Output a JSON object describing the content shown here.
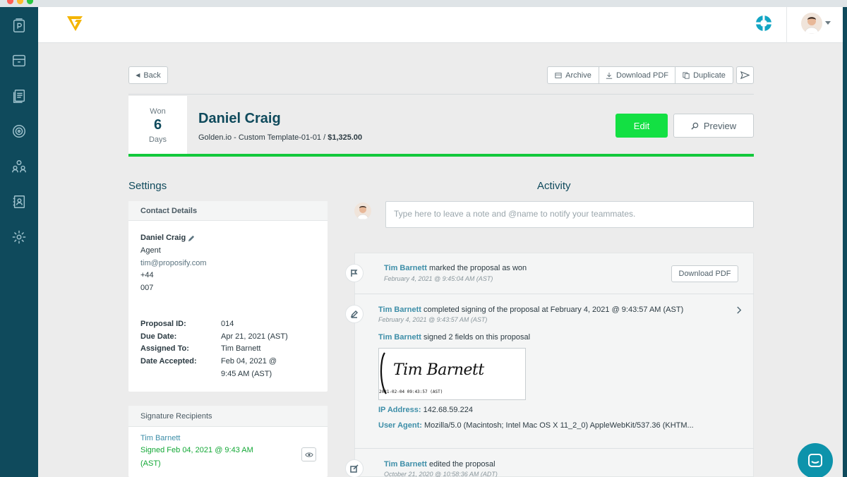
{
  "app": {
    "colors": {
      "rail": "#0f4a5c",
      "accent_green": "#13e043",
      "progress_green": "#13c93c",
      "link": "#3d8ea8"
    }
  },
  "rail_icons": [
    "proposals-icon",
    "archive-icon",
    "documents-icon",
    "target-icon",
    "team-icon",
    "contacts-icon",
    "gear-icon"
  ],
  "topbar": {
    "help_icon": "lifebuoy-icon",
    "avatar_icon": "user-avatar"
  },
  "toolbar": {
    "back_label": "Back",
    "archive_label": "Archive",
    "download_pdf_label": "Download PDF",
    "duplicate_label": "Duplicate"
  },
  "header": {
    "status_label": "Won",
    "status_count": "6",
    "status_unit": "Days",
    "client_name": "Daniel Craig",
    "subtitle": "Golden.io - Custom Template-01-01 /",
    "amount": "$1,325.00",
    "edit_label": "Edit",
    "preview_label": "Preview"
  },
  "settings": {
    "title": "Settings",
    "contact": {
      "heading": "Contact Details",
      "name": "Daniel Craig",
      "role": "Agent",
      "email": "tim@proposify.com",
      "phone_line1": "+44",
      "phone_line2": "007"
    },
    "proposal": {
      "id_label": "Proposal ID:",
      "id_value": "014",
      "due_label": "Due Date:",
      "due_value": "Apr 21, 2021 (AST)",
      "assigned_label": "Assigned To:",
      "assigned_value": "Tim Barnett",
      "accepted_label": "Date Accepted:",
      "accepted_line1": "Feb 04, 2021 @",
      "accepted_line2": "9:45 AM (AST)"
    },
    "signature": {
      "heading": "Signature Recipients",
      "name": "Tim Barnett",
      "signed_line1": "Signed Feb 04, 2021 @ 9:43 AM",
      "signed_line2": "(AST)"
    }
  },
  "activity": {
    "title": "Activity",
    "note_placeholder": "Type here to leave a note and @name to notify your teammates.",
    "items": [
      {
        "who": "Tim Barnett",
        "text": " marked the proposal as won",
        "time": "February 4, 2021 @ 9:45:04 AM (AST)",
        "button": "Download PDF"
      },
      {
        "who": "Tim Barnett",
        "text": " completed signing of the proposal at February 4, 2021 @ 9:43:57 AM (AST)",
        "time": "February 4, 2021 @ 9:43:57 AM (AST)",
        "detail_who": "Tim Barnett",
        "detail_text": " signed 2 fields on this proposal",
        "signature_text": "Tim Barnett",
        "signature_stamp": "2021-02-04 09:43:57 (AST)",
        "ip_label": "IP Address:",
        "ip_value": "142.68.59.224",
        "ua_label": "User Agent:",
        "ua_value": "Mozilla/5.0 (Macintosh; Intel Mac OS X 11_2_0) AppleWebKit/537.36 (KHTM..."
      },
      {
        "who": "Tim Barnett",
        "text": " edited the proposal",
        "time": "October 21, 2020 @ 10:58:36 AM (ADT)"
      }
    ]
  }
}
